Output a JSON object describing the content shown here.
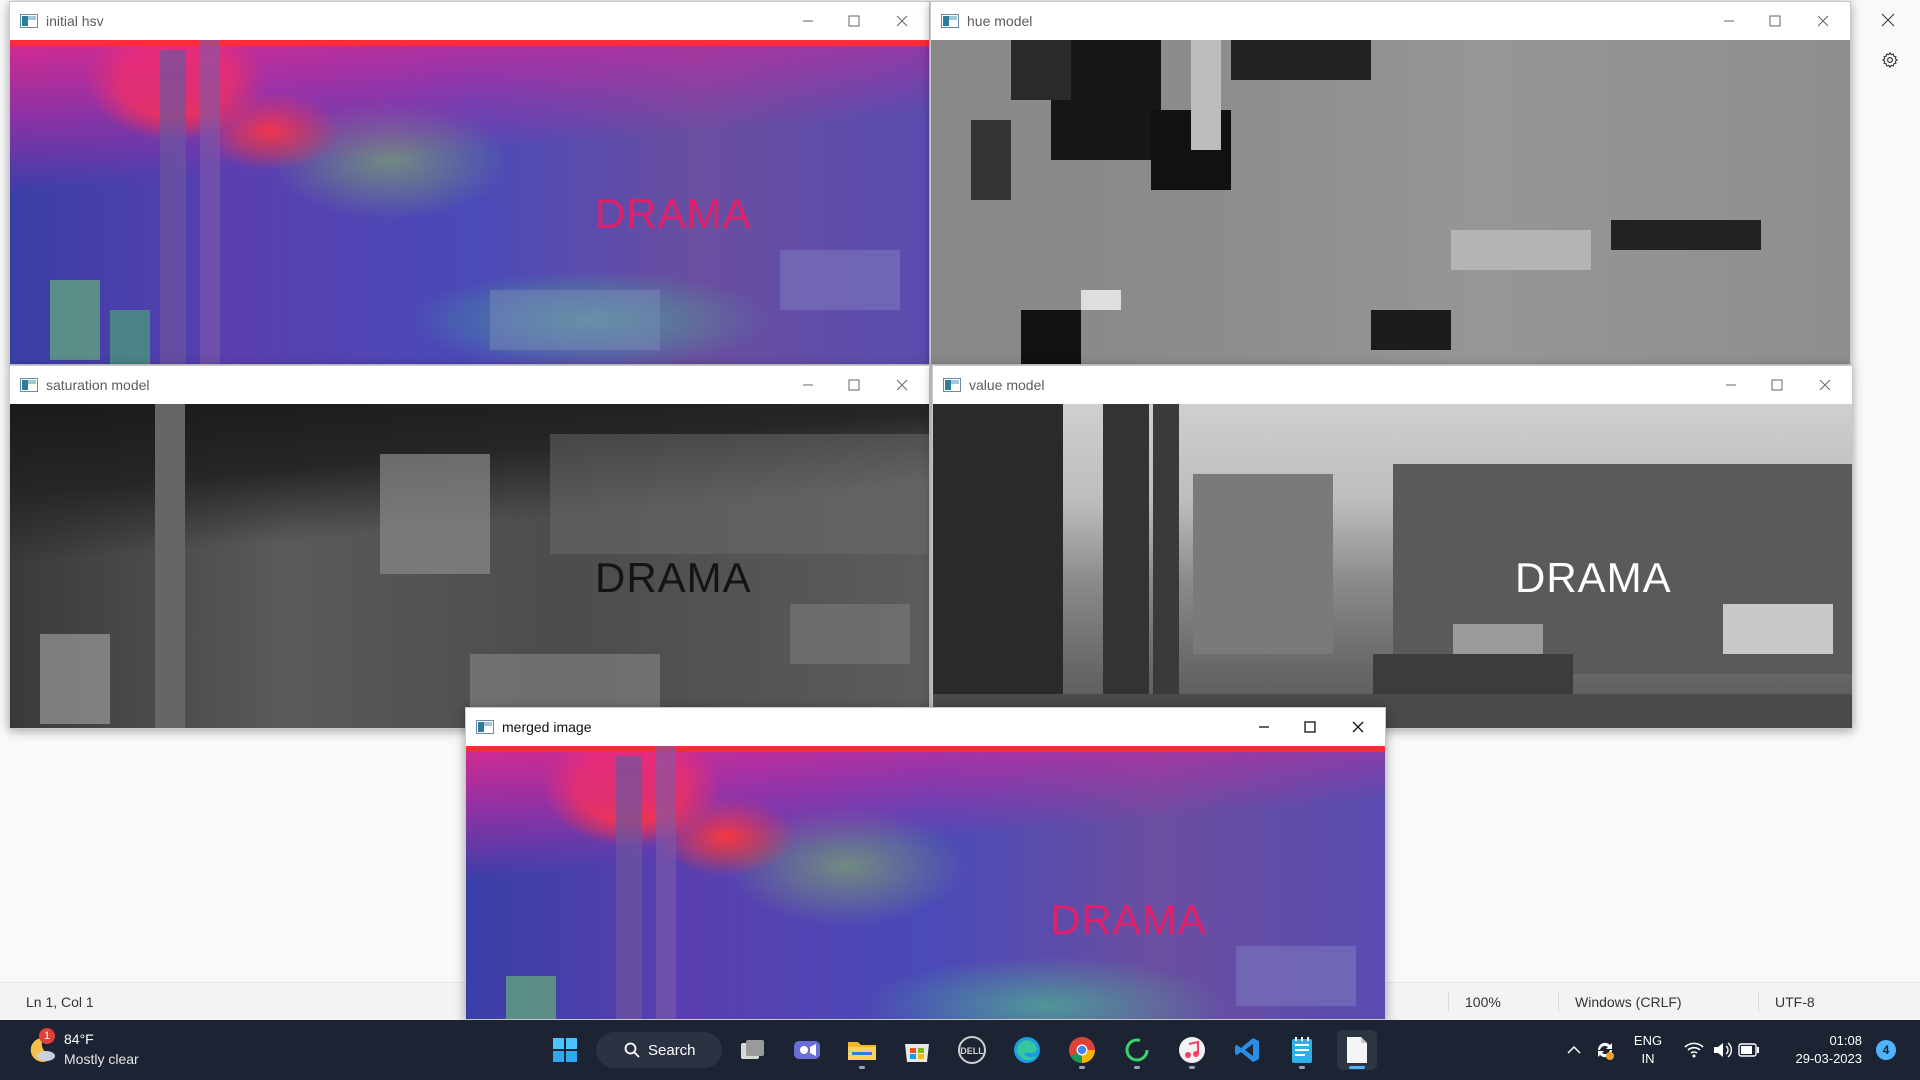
{
  "notepad": {
    "status": {
      "position": "Ln 1, Col 1",
      "zoom": "100%",
      "line_ending": "Windows (CRLF)",
      "encoding": "UTF-8"
    }
  },
  "windows": {
    "initial_hsv": {
      "title": "initial hsv",
      "overlay_text": "DRAMA"
    },
    "hue": {
      "title": "hue model"
    },
    "saturation": {
      "title": "saturation model",
      "overlay_text": "DRAMA"
    },
    "value": {
      "title": "value model",
      "overlay_text": "DRAMA"
    },
    "merged": {
      "title": "merged image",
      "overlay_text": "DRAMA"
    }
  },
  "taskbar": {
    "weather": {
      "temp": "84°F",
      "condition": "Mostly clear",
      "badge": "1"
    },
    "search_label": "Search",
    "apps": [
      "task-view",
      "teams-meet",
      "file-explorer",
      "microsoft-store",
      "dell",
      "edge",
      "chrome",
      "loader",
      "itunes",
      "vscode",
      "notepad-blue",
      "notepad"
    ],
    "tray": {
      "lang1": "ENG",
      "lang2": "IN",
      "time": "01:08",
      "date": "29-03-2023",
      "notifications": "4"
    }
  },
  "colors": {
    "taskbar": "#1c2332",
    "drama_pink": "#e0206a",
    "window_bg": "#ffffff",
    "accent": "#4fb3ff"
  }
}
